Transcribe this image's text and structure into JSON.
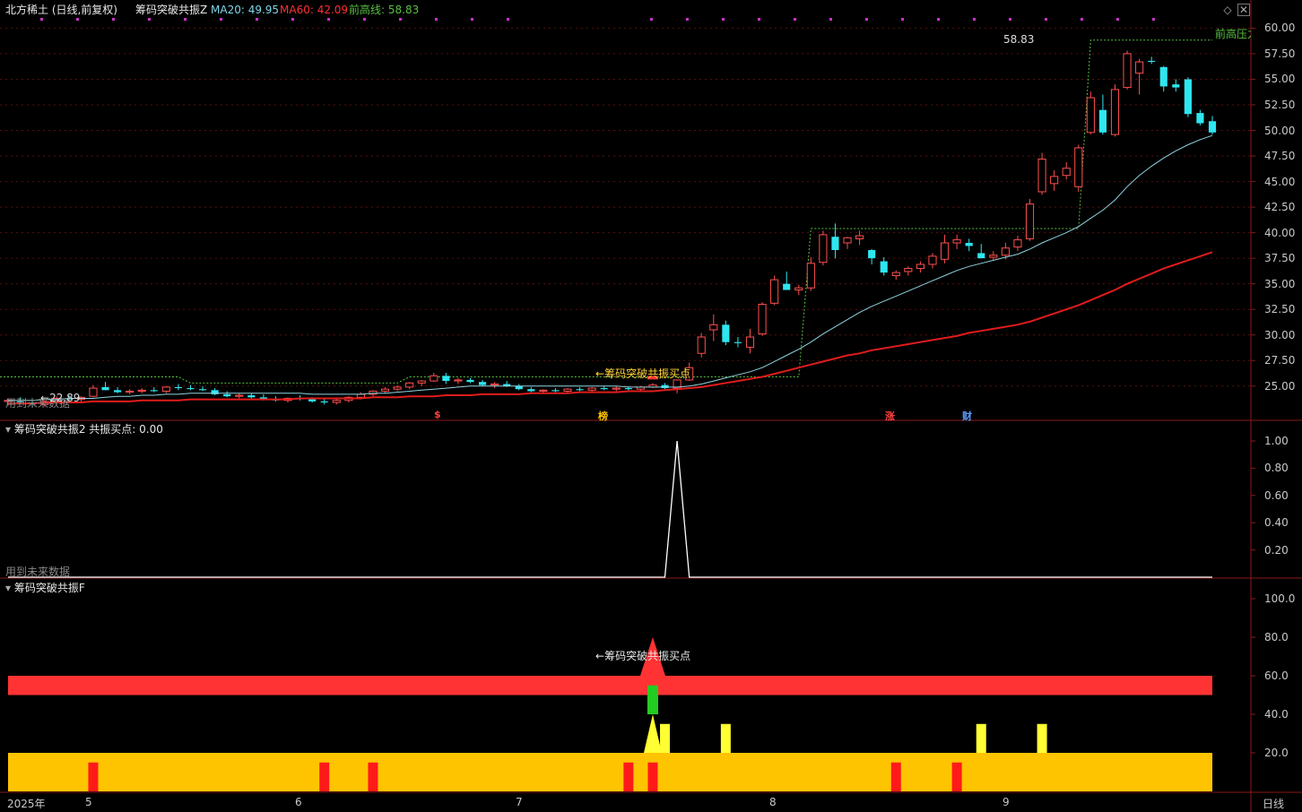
{
  "header": {
    "stock": "北方稀土 (日线,前复权)",
    "indicator": "筹码突破共振Z",
    "ma20_label": "MA20: 49.95",
    "ma60_label": "MA60: 42.09",
    "prev_high_label": "前高线: 58.83",
    "future_note": "用到未来数据"
  },
  "panel2": {
    "title": "筹码突破共振2 共振买点: 0.00",
    "future_note": "用到未来数据"
  },
  "panel3": {
    "title": "筹码突破共振F"
  },
  "annotations": {
    "high_value": "58.83",
    "low_value": "22.89",
    "buy_point": "筹码突破共振买点",
    "prev_high_tag": "前高压力",
    "events": [
      "$",
      "榜",
      "涨",
      "财"
    ]
  },
  "bottom_bar": {
    "year": "2025年",
    "period": "日线",
    "months": [
      "5",
      "6",
      "7",
      "8",
      "9"
    ]
  },
  "colors": {
    "up": "#ff4f4f",
    "down": "#2ee6f0",
    "ma20": "#8fd4e0",
    "ma60": "#e01c1c",
    "prev_high": "#59c040",
    "yellow": "#ffff33",
    "orange": "#ffc400",
    "red": "#ff3333",
    "green": "#22cc22"
  },
  "chart_data": [
    {
      "type": "candlestick",
      "ylim": [
        22.0,
        61.0
      ],
      "y_ticks": [
        25.0,
        27.5,
        30.0,
        32.5,
        35.0,
        37.5,
        40.0,
        42.5,
        45.0,
        47.5,
        50.0,
        52.5,
        55.0,
        57.5,
        60.0
      ],
      "ohlc": [
        [
          23.5,
          23.8,
          23.1,
          23.6
        ],
        [
          23.5,
          23.9,
          23.2,
          23.4
        ],
        [
          23.3,
          23.6,
          22.9,
          23.2
        ],
        [
          23.2,
          23.6,
          23.0,
          23.5
        ],
        [
          23.5,
          24.0,
          23.3,
          23.8
        ],
        [
          23.8,
          24.1,
          23.5,
          23.7
        ],
        [
          23.7,
          24.0,
          23.4,
          23.9
        ],
        [
          24.0,
          25.1,
          23.9,
          24.8
        ],
        [
          24.9,
          25.4,
          24.6,
          24.6
        ],
        [
          24.6,
          24.9,
          24.3,
          24.4
        ],
        [
          24.4,
          24.7,
          24.2,
          24.5
        ],
        [
          24.5,
          24.8,
          24.3,
          24.6
        ],
        [
          24.6,
          24.9,
          24.4,
          24.5
        ],
        [
          24.5,
          25.0,
          24.3,
          24.9
        ],
        [
          24.9,
          25.2,
          24.6,
          24.8
        ],
        [
          24.8,
          25.1,
          24.6,
          24.7
        ],
        [
          24.7,
          25.0,
          24.5,
          24.6
        ],
        [
          24.6,
          24.8,
          24.1,
          24.2
        ],
        [
          24.2,
          24.5,
          23.9,
          24.0
        ],
        [
          24.0,
          24.3,
          23.8,
          24.1
        ],
        [
          24.1,
          24.3,
          23.8,
          23.9
        ],
        [
          23.9,
          24.2,
          23.6,
          23.7
        ],
        [
          23.7,
          24.0,
          23.5,
          23.6
        ],
        [
          23.6,
          23.9,
          23.4,
          23.8
        ],
        [
          23.8,
          24.1,
          23.6,
          23.7
        ],
        [
          23.7,
          23.9,
          23.4,
          23.5
        ],
        [
          23.5,
          23.8,
          23.2,
          23.4
        ],
        [
          23.4,
          23.7,
          23.2,
          23.6
        ],
        [
          23.6,
          24.0,
          23.4,
          23.9
        ],
        [
          23.9,
          24.4,
          23.7,
          24.2
        ],
        [
          24.2,
          24.6,
          24.0,
          24.5
        ],
        [
          24.5,
          24.9,
          24.3,
          24.7
        ],
        [
          24.7,
          25.1,
          24.5,
          24.9
        ],
        [
          24.9,
          25.4,
          24.7,
          25.3
        ],
        [
          25.3,
          25.6,
          25.0,
          25.5
        ],
        [
          25.5,
          26.3,
          25.4,
          26.0
        ],
        [
          26.0,
          26.3,
          25.2,
          25.5
        ],
        [
          25.5,
          25.8,
          25.2,
          25.6
        ],
        [
          25.6,
          25.8,
          25.3,
          25.4
        ],
        [
          25.4,
          25.6,
          25.0,
          25.1
        ],
        [
          25.1,
          25.4,
          24.8,
          25.2
        ],
        [
          25.2,
          25.5,
          24.9,
          25.0
        ],
        [
          25.0,
          25.2,
          24.6,
          24.7
        ],
        [
          24.7,
          24.9,
          24.4,
          24.5
        ],
        [
          24.5,
          24.7,
          24.3,
          24.6
        ],
        [
          24.6,
          24.8,
          24.4,
          24.5
        ],
        [
          24.5,
          24.8,
          24.3,
          24.7
        ],
        [
          24.7,
          24.9,
          24.5,
          24.6
        ],
        [
          24.6,
          24.9,
          24.4,
          24.8
        ],
        [
          24.8,
          25.0,
          24.6,
          24.7
        ],
        [
          24.7,
          25.0,
          24.5,
          24.8
        ],
        [
          24.8,
          25.0,
          24.6,
          24.7
        ],
        [
          24.7,
          25.0,
          24.5,
          24.9
        ],
        [
          24.9,
          25.3,
          24.8,
          25.1
        ],
        [
          25.1,
          25.3,
          24.7,
          24.8
        ],
        [
          24.8,
          25.5,
          24.3,
          25.6
        ],
        [
          25.6,
          27.3,
          25.5,
          26.8
        ],
        [
          28.2,
          30.2,
          27.8,
          29.8
        ],
        [
          30.5,
          32.0,
          29.4,
          31.0
        ],
        [
          31.0,
          31.4,
          29.0,
          29.3
        ],
        [
          29.3,
          29.8,
          28.8,
          29.2
        ],
        [
          28.8,
          30.6,
          28.2,
          29.8
        ],
        [
          30.1,
          33.2,
          29.9,
          33.0
        ],
        [
          33.1,
          35.8,
          32.9,
          35.4
        ],
        [
          35.0,
          36.2,
          34.5,
          34.4
        ],
        [
          34.4,
          34.9,
          33.9,
          34.6
        ],
        [
          34.6,
          37.6,
          34.3,
          37.0
        ],
        [
          37.1,
          40.2,
          36.8,
          39.8
        ],
        [
          39.6,
          40.9,
          37.5,
          38.3
        ],
        [
          39.0,
          39.6,
          38.4,
          39.5
        ],
        [
          39.4,
          40.2,
          38.8,
          39.7
        ],
        [
          38.3,
          38.4,
          36.9,
          37.5
        ],
        [
          37.2,
          37.6,
          35.8,
          36.1
        ],
        [
          35.8,
          36.3,
          35.4,
          36.1
        ],
        [
          36.2,
          36.7,
          35.8,
          36.5
        ],
        [
          36.5,
          37.2,
          36.1,
          36.9
        ],
        [
          36.9,
          38.0,
          36.5,
          37.7
        ],
        [
          37.4,
          39.8,
          37.0,
          39.0
        ],
        [
          39.0,
          39.8,
          38.4,
          39.3
        ],
        [
          39.0,
          39.4,
          38.2,
          38.7
        ],
        [
          38.0,
          38.9,
          37.5,
          37.5
        ],
        [
          37.6,
          38.2,
          37.3,
          37.8
        ],
        [
          37.8,
          39.0,
          37.4,
          38.5
        ],
        [
          38.6,
          39.7,
          38.2,
          39.3
        ],
        [
          39.4,
          43.3,
          39.2,
          42.8
        ],
        [
          44.0,
          47.8,
          43.7,
          47.2
        ],
        [
          44.8,
          46.1,
          44.1,
          45.5
        ],
        [
          45.6,
          46.9,
          45.2,
          46.3
        ],
        [
          44.5,
          48.6,
          44.0,
          48.3
        ],
        [
          49.8,
          53.8,
          49.6,
          53.2
        ],
        [
          52.0,
          53.5,
          49.6,
          49.8
        ],
        [
          49.6,
          54.5,
          49.4,
          54.0
        ],
        [
          54.2,
          57.8,
          54.0,
          57.5
        ],
        [
          55.6,
          57.0,
          53.5,
          56.7
        ],
        [
          56.8,
          57.2,
          56.5,
          56.7
        ],
        [
          56.2,
          56.3,
          53.8,
          54.3
        ],
        [
          54.5,
          55.0,
          53.8,
          54.2
        ],
        [
          55.0,
          55.2,
          51.3,
          51.6
        ],
        [
          51.7,
          52.0,
          50.5,
          50.7
        ],
        [
          50.9,
          51.4,
          49.6,
          49.8
        ]
      ],
      "ma20": [
        23.6,
        23.6,
        23.6,
        23.7,
        23.7,
        23.8,
        23.8,
        23.8,
        23.9,
        24.0,
        24.0,
        24.1,
        24.1,
        24.2,
        24.2,
        24.3,
        24.3,
        24.3,
        24.3,
        24.3,
        24.3,
        24.3,
        24.3,
        24.3,
        24.3,
        24.2,
        24.2,
        24.2,
        24.2,
        24.2,
        24.3,
        24.3,
        24.4,
        24.5,
        24.6,
        24.7,
        24.8,
        24.9,
        25.0,
        25.0,
        25.0,
        25.0,
        25.0,
        25.0,
        25.0,
        25.0,
        25.0,
        25.0,
        25.0,
        25.0,
        25.0,
        24.9,
        24.9,
        24.9,
        24.9,
        24.9,
        25.0,
        25.2,
        25.5,
        25.8,
        26.1,
        26.4,
        26.8,
        27.4,
        28.0,
        28.6,
        29.3,
        30.1,
        30.8,
        31.5,
        32.2,
        32.8,
        33.3,
        33.8,
        34.3,
        34.8,
        35.3,
        35.8,
        36.3,
        36.7,
        37.0,
        37.3,
        37.6,
        37.9,
        38.4,
        39.0,
        39.5,
        40.0,
        40.6,
        41.4,
        42.2,
        43.2,
        44.5,
        45.6,
        46.5,
        47.3,
        48.0,
        48.6,
        49.1,
        49.5
      ],
      "ma60": [
        23.3,
        23.3,
        23.3,
        23.4,
        23.4,
        23.4,
        23.4,
        23.5,
        23.5,
        23.5,
        23.5,
        23.6,
        23.6,
        23.6,
        23.6,
        23.7,
        23.7,
        23.7,
        23.7,
        23.7,
        23.7,
        23.7,
        23.7,
        23.7,
        23.8,
        23.8,
        23.8,
        23.8,
        23.8,
        23.8,
        23.9,
        23.9,
        23.9,
        24.0,
        24.0,
        24.0,
        24.1,
        24.1,
        24.1,
        24.2,
        24.2,
        24.2,
        24.2,
        24.3,
        24.3,
        24.3,
        24.3,
        24.4,
        24.4,
        24.4,
        24.4,
        24.5,
        24.5,
        24.5,
        24.6,
        24.7,
        24.8,
        24.9,
        25.1,
        25.3,
        25.5,
        25.7,
        25.9,
        26.2,
        26.5,
        26.8,
        27.1,
        27.4,
        27.7,
        28.0,
        28.2,
        28.5,
        28.7,
        28.9,
        29.1,
        29.3,
        29.5,
        29.7,
        29.9,
        30.2,
        30.4,
        30.6,
        30.8,
        31.0,
        31.3,
        31.7,
        32.1,
        32.5,
        32.9,
        33.4,
        33.9,
        34.4,
        35.0,
        35.5,
        36.0,
        36.5,
        36.9,
        37.3,
        37.7,
        38.1
      ]
    },
    {
      "type": "line",
      "ylim": [
        0.0,
        1.0
      ],
      "y_ticks": [
        0.2,
        0.4,
        0.6,
        0.8,
        1.0
      ],
      "values": [
        0,
        0,
        0,
        0,
        0,
        0,
        0,
        0,
        0,
        0,
        0,
        0,
        0,
        0,
        0,
        0,
        0,
        0,
        0,
        0,
        0,
        0,
        0,
        0,
        0,
        0,
        0,
        0,
        0,
        0,
        0,
        0,
        0,
        0,
        0,
        0,
        0,
        0,
        0,
        0,
        0,
        0,
        0,
        0,
        0,
        0,
        0,
        0,
        0,
        0,
        0,
        0,
        0,
        0,
        0,
        1,
        0,
        0,
        0,
        0,
        0,
        0,
        0,
        0,
        0,
        0,
        0,
        0,
        0,
        0,
        0,
        0,
        0,
        0,
        0,
        0,
        0,
        0,
        0,
        0,
        0,
        0,
        0,
        0,
        0,
        0,
        0,
        0,
        0,
        0,
        0,
        0,
        0,
        0,
        0,
        0,
        0,
        0,
        0,
        0
      ]
    },
    {
      "type": "bar",
      "ylim": [
        0.0,
        100.0
      ],
      "y_ticks": [
        20.0,
        40.0,
        60.0,
        80.0,
        100.0
      ],
      "orange_band": [
        0,
        20
      ],
      "red_band": [
        50,
        60
      ],
      "red_bars": [
        7,
        26,
        30,
        51,
        53,
        73,
        78
      ],
      "yellow_bars": [
        54,
        59,
        80,
        85
      ],
      "green_bar": 53,
      "signal_index": 53
    }
  ]
}
